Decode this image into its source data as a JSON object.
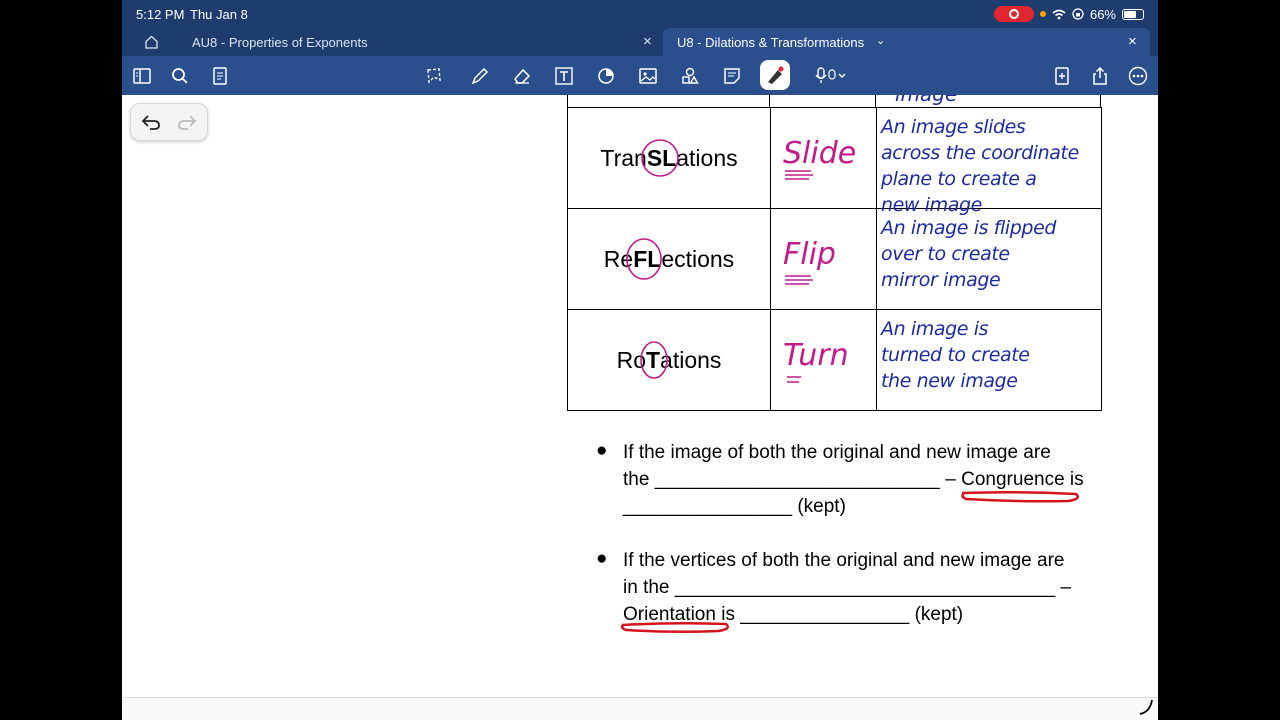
{
  "status_bar": {
    "time": "5:12 PM",
    "date": "Thu Jan 8",
    "battery": "66%",
    "battery_level": 0.66
  },
  "tabs": [
    {
      "label": "AU8 - Properties of Exponents"
    },
    {
      "label": "U8 - Dilations & Transformations"
    }
  ],
  "toolbar": {
    "icons": [
      "sidebar-icon",
      "search-icon",
      "page-outline-icon",
      "lasso-icon",
      "pencil-icon",
      "eraser-icon",
      "text-icon",
      "shapes-icon",
      "image-icon",
      "stickers-icon",
      "sticky-note-icon",
      "highlighter-pen-icon",
      "microphone-icon",
      "add-page-icon",
      "share-icon",
      "more-icon"
    ]
  },
  "table": {
    "rows": [
      {
        "pre": "Tran",
        "bold": "SL",
        "post": "ations",
        "hand_word": "Slide",
        "description": "An image slides\nacross the coordinate\nplane to create a\nnew image"
      },
      {
        "pre": "Re",
        "bold": "FL",
        "post": "ections",
        "hand_word": "Flip",
        "description": "An image is flipped\nover to create\nmirror image"
      },
      {
        "pre": "Ro",
        "bold": "T",
        "post": "ations",
        "hand_word": "Turn",
        "description": "An image is\nturned to create\nthe new image"
      }
    ],
    "cut_off_text": "image"
  },
  "bullets": [
    {
      "line1": "If the image of both the original and new image are",
      "line2": "the ___________________________ – Congruence is",
      "line3": "________________ (kept)"
    },
    {
      "line1": "If the vertices of both the original and new image are",
      "line2": "in the ____________________________________ –",
      "line3": "Orientation is ________________ (kept)"
    }
  ],
  "colors": {
    "toolbar": "#2a4f8c",
    "status_bar": "#1f3c6e",
    "ink_pink": "#c21a8a",
    "ink_blue": "#1a2aa0",
    "ink_red": "#d4141c"
  }
}
